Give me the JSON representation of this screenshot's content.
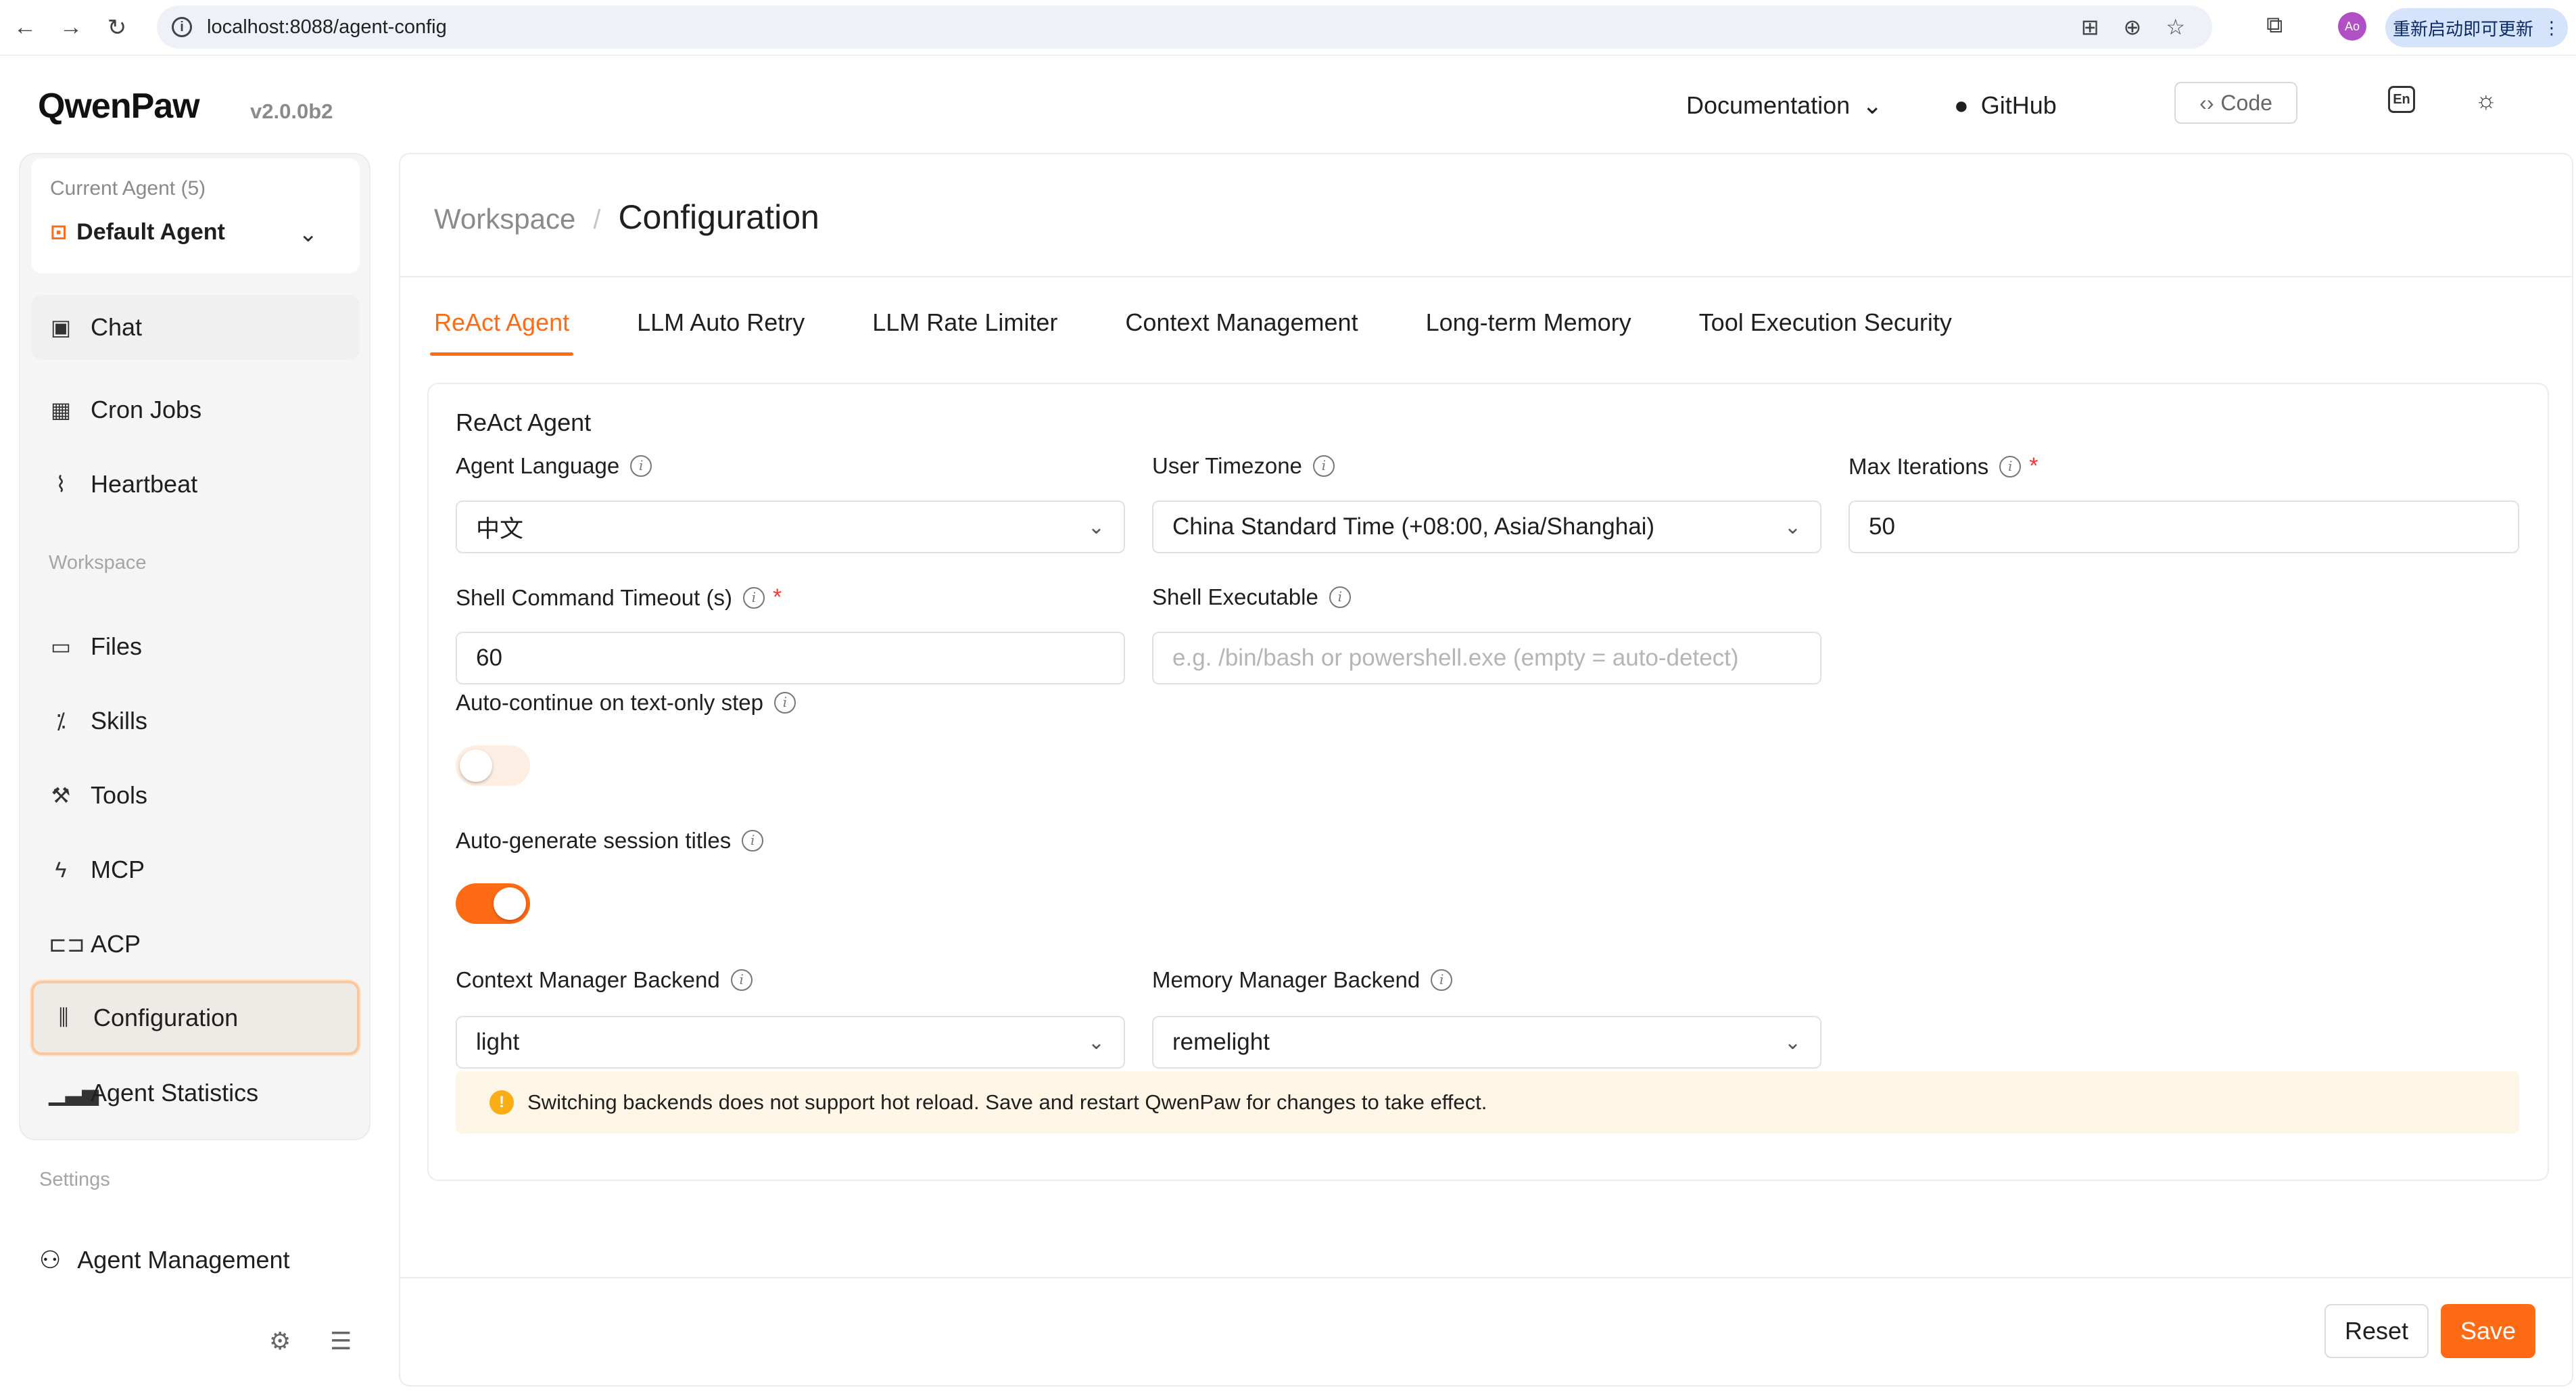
{
  "browser": {
    "url": "localhost:8088/agent-config",
    "update_label": "重新启动即可更新",
    "profile_initials": "Ao"
  },
  "header": {
    "logo": "QwenPaw",
    "version": "v2.0.0b2",
    "docs": "Documentation",
    "github": "GitHub",
    "code": "Code",
    "lang": "En"
  },
  "sidebar": {
    "current_agent_caption": "Current Agent (5)",
    "agent_name": "Default Agent",
    "items": [
      {
        "label": "Chat",
        "icon": "chat-icon"
      },
      {
        "label": "Cron Jobs",
        "icon": "calendar-icon"
      },
      {
        "label": "Heartbeat",
        "icon": "pulse-icon"
      }
    ],
    "workspace_label": "Workspace",
    "workspace_items": [
      {
        "label": "Files",
        "icon": "folder-icon"
      },
      {
        "label": "Skills",
        "icon": "skills-icon"
      },
      {
        "label": "Tools",
        "icon": "wrench-icon"
      },
      {
        "label": "MCP",
        "icon": "plug-icon"
      },
      {
        "label": "ACP",
        "icon": "scan-icon"
      },
      {
        "label": "Configuration",
        "icon": "sliders-icon"
      },
      {
        "label": "Agent Statistics",
        "icon": "bar-chart-icon"
      }
    ],
    "settings_label": "Settings",
    "agent_management": "Agent Management"
  },
  "main": {
    "breadcrumb": {
      "parent": "Workspace",
      "current": "Configuration"
    },
    "tabs": [
      "ReAct Agent",
      "LLM Auto Retry",
      "LLM Rate Limiter",
      "Context Management",
      "Long-term Memory",
      "Tool Execution Security"
    ],
    "active_tab": "ReAct Agent",
    "card_title": "ReAct Agent",
    "fields": {
      "agent_language": {
        "label": "Agent Language",
        "value": "中文"
      },
      "user_timezone": {
        "label": "User Timezone",
        "value": "China Standard Time (+08:00, Asia/Shanghai)"
      },
      "max_iterations": {
        "label": "Max Iterations",
        "value": "50"
      },
      "shell_timeout": {
        "label": "Shell Command Timeout (s)",
        "value": "60"
      },
      "shell_executable": {
        "label": "Shell Executable",
        "placeholder": "e.g. /bin/bash or powershell.exe (empty = auto-detect)"
      },
      "auto_continue": {
        "label": "Auto-continue on text-only step",
        "enabled": false
      },
      "auto_titles": {
        "label": "Auto-generate session titles",
        "enabled": true
      },
      "context_backend": {
        "label": "Context Manager Backend",
        "value": "light"
      },
      "memory_backend": {
        "label": "Memory Manager Backend",
        "value": "remelight"
      }
    },
    "alert": "Switching backends does not support hot reload. Save and restart QwenPaw for changes to take effect.",
    "buttons": {
      "reset": "Reset",
      "save": "Save"
    }
  },
  "colors": {
    "accent": "#ff6a14",
    "warning": "#faad14"
  }
}
